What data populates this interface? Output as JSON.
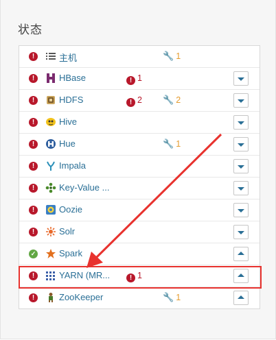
{
  "panel": {
    "title": "状态"
  },
  "services": [
    {
      "name": "主机",
      "status": "error",
      "icon": "host-list-icon",
      "alerts": "",
      "config": "1",
      "menu": "none"
    },
    {
      "name": "HBase",
      "status": "error",
      "icon": "hbase-icon",
      "alerts": "1",
      "config": "",
      "menu": "closed"
    },
    {
      "name": "HDFS",
      "status": "error",
      "icon": "hdfs-icon",
      "alerts": "2",
      "config": "2",
      "menu": "closed"
    },
    {
      "name": "Hive",
      "status": "error",
      "icon": "hive-icon",
      "alerts": "",
      "config": "",
      "menu": "closed"
    },
    {
      "name": "Hue",
      "status": "error",
      "icon": "hue-icon",
      "alerts": "",
      "config": "1",
      "menu": "closed"
    },
    {
      "name": "Impala",
      "status": "error",
      "icon": "impala-icon",
      "alerts": "",
      "config": "",
      "menu": "closed"
    },
    {
      "name": "Key-Value ...",
      "status": "error",
      "icon": "key-value-icon",
      "alerts": "",
      "config": "",
      "menu": "closed"
    },
    {
      "name": "Oozie",
      "status": "error",
      "icon": "oozie-icon",
      "alerts": "",
      "config": "",
      "menu": "closed"
    },
    {
      "name": "Solr",
      "status": "error",
      "icon": "solr-icon",
      "alerts": "",
      "config": "",
      "menu": "closed"
    },
    {
      "name": "Spark",
      "status": "ok",
      "icon": "spark-icon",
      "alerts": "",
      "config": "",
      "menu": "open"
    },
    {
      "name": "YARN (MR...",
      "status": "error",
      "icon": "yarn-icon",
      "alerts": "1",
      "config": "",
      "menu": "open"
    },
    {
      "name": "ZooKeeper",
      "status": "error",
      "icon": "zookeeper-icon",
      "alerts": "",
      "config": "1",
      "menu": "open"
    }
  ],
  "colors": {
    "error": "#b8182b",
    "ok": "#62a744",
    "link": "#2a6f96",
    "config": "#e49b2d",
    "annotation": "#e8322e"
  }
}
